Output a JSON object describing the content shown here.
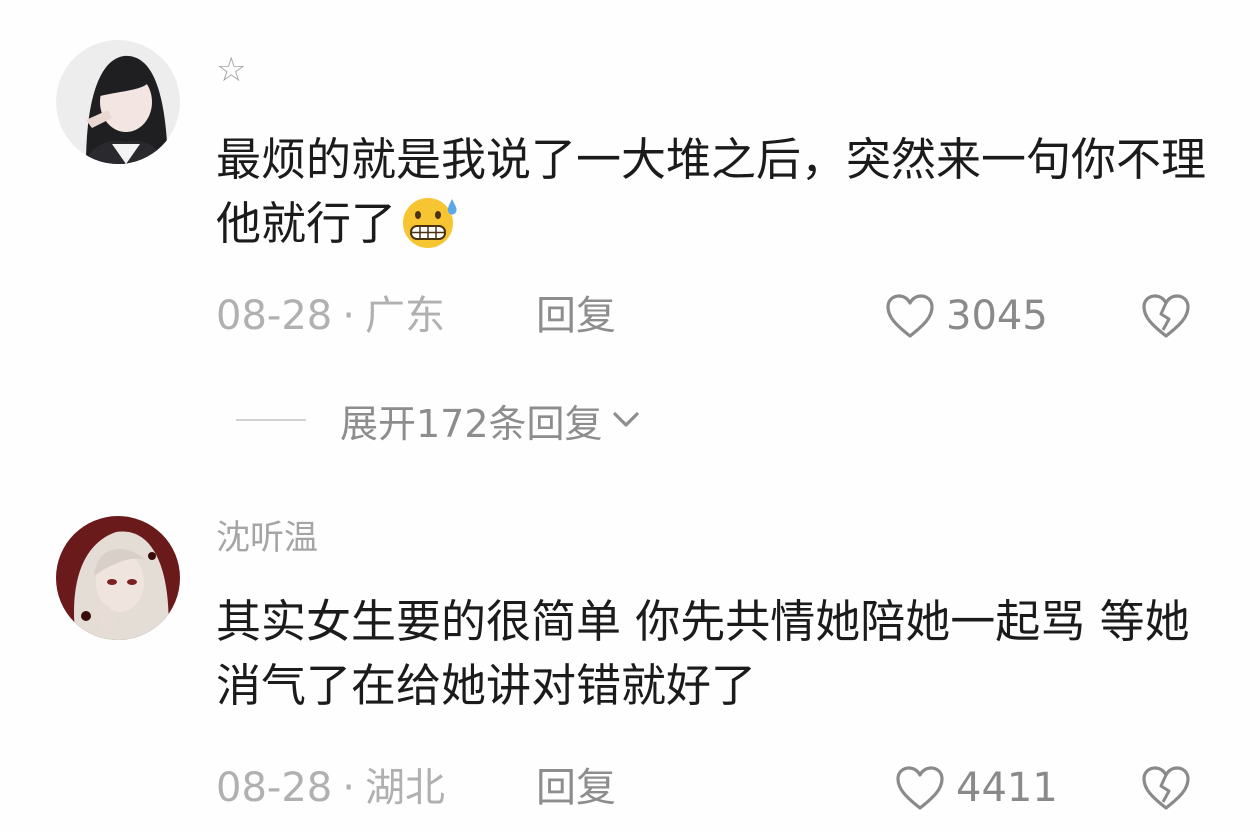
{
  "comments": [
    {
      "username": "☆",
      "text": "最烦的就是我说了一大堆之后，突然来一句你不理他就行了",
      "emoji": "grimacing-sweat-emoji",
      "date": "08-28",
      "location": "广东",
      "reply_label": "回复",
      "likes": "3045",
      "expand_label": "展开172条回复"
    },
    {
      "username": "沈听温",
      "text": "其实女生要的很简单 你先共情她陪她一起骂 等她消气了在给她讲对错就好了",
      "date": "08-28",
      "location": "湖北",
      "reply_label": "回复",
      "likes": "4411"
    }
  ],
  "separator": "·",
  "colors": {
    "background": "#fefefe",
    "text": "#1b1b1b",
    "meta": "#b0b0b0",
    "action": "#8a8a8a"
  }
}
